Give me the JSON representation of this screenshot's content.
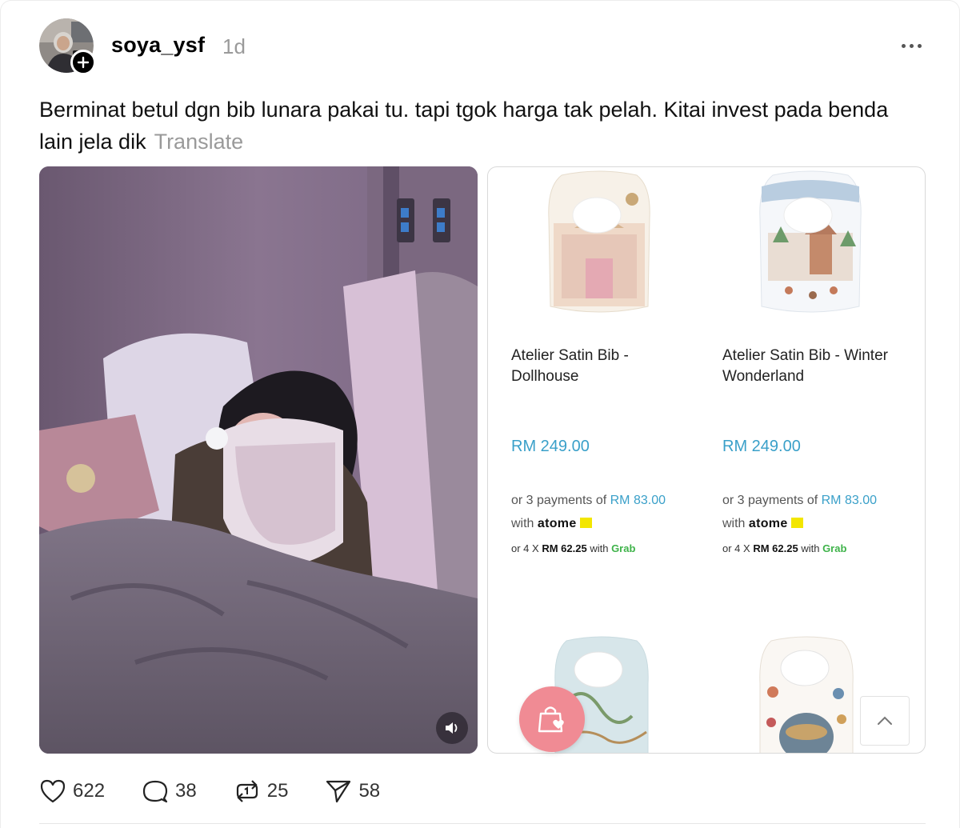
{
  "post": {
    "username": "soya_ysf",
    "time": "1d",
    "caption": "Berminat betul dgn bib lunara pakai tu. tapi tgok harga tak pelah. Kitai invest pada benda lain jela dik",
    "translate_label": "Translate"
  },
  "shop": {
    "products": [
      {
        "name": "Atelier Satin Bib - Dollhouse",
        "price": "RM 249.00",
        "installment_prefix": "or 3 payments of",
        "installment_amount": "RM 83.00",
        "with_label": "with",
        "provider": "atome",
        "grab_prefix": "or 4 X",
        "grab_amount": "RM 62.25",
        "grab_with": "with",
        "grab_provider": "Grab"
      },
      {
        "name": "Atelier Satin Bib - Winter Wonderland",
        "price": "RM 249.00",
        "installment_prefix": "or 3 payments of",
        "installment_amount": "RM 83.00",
        "with_label": "with",
        "provider": "atome",
        "grab_prefix": "or 4 X",
        "grab_amount": "RM 62.25",
        "grab_with": "with",
        "grab_provider": "Grab"
      }
    ]
  },
  "actions": {
    "likes": "622",
    "replies": "38",
    "reposts": "25",
    "shares": "58"
  },
  "icons": {
    "follow": "plus-icon",
    "more": "ellipsis-icon",
    "sound": "speaker-icon",
    "bag": "shopping-bag-heart-icon",
    "scroll_top": "chevron-up-icon",
    "like": "heart-icon",
    "reply": "speech-bubble-icon",
    "repost": "repost-icon",
    "share": "send-icon"
  },
  "colors": {
    "price_blue": "#3aa0c9",
    "bag_pink": "#f08b94",
    "muted_gray": "#9a9a9a",
    "grab_green": "#3fb34a"
  }
}
